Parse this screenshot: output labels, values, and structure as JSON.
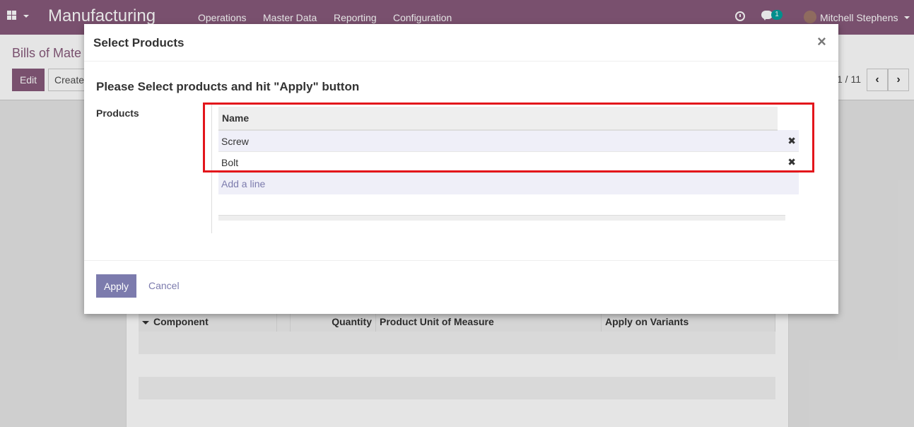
{
  "navbar": {
    "brand": "Manufacturing",
    "menu": [
      "Operations",
      "Master Data",
      "Reporting",
      "Configuration"
    ],
    "chat_count": "1",
    "user_name": "Mitchell Stephens",
    "color": "#875a7b"
  },
  "control_panel": {
    "breadcrumb": "Bills of Mate",
    "edit_label": "Edit",
    "create_label": "Create",
    "pager": "1 / 11",
    "prev_icon": "‹",
    "next_icon": "›"
  },
  "bg_table": {
    "headers": [
      "Component",
      "Quantity",
      "Product Unit of Measure",
      "Apply on Variants"
    ]
  },
  "modal": {
    "title": "Select Products",
    "close": "×",
    "heading": "Please Select products and hit \"Apply\" button",
    "field_label": "Products",
    "lines": {
      "header": "Name",
      "rows": [
        {
          "name": "Screw",
          "delete": "✖"
        },
        {
          "name": "Bolt",
          "delete": "✖"
        }
      ],
      "add_line": "Add a line"
    },
    "apply_label": "Apply",
    "cancel_label": "Cancel",
    "accent": "#7c7bad",
    "highlight_color": "#e3151b"
  }
}
